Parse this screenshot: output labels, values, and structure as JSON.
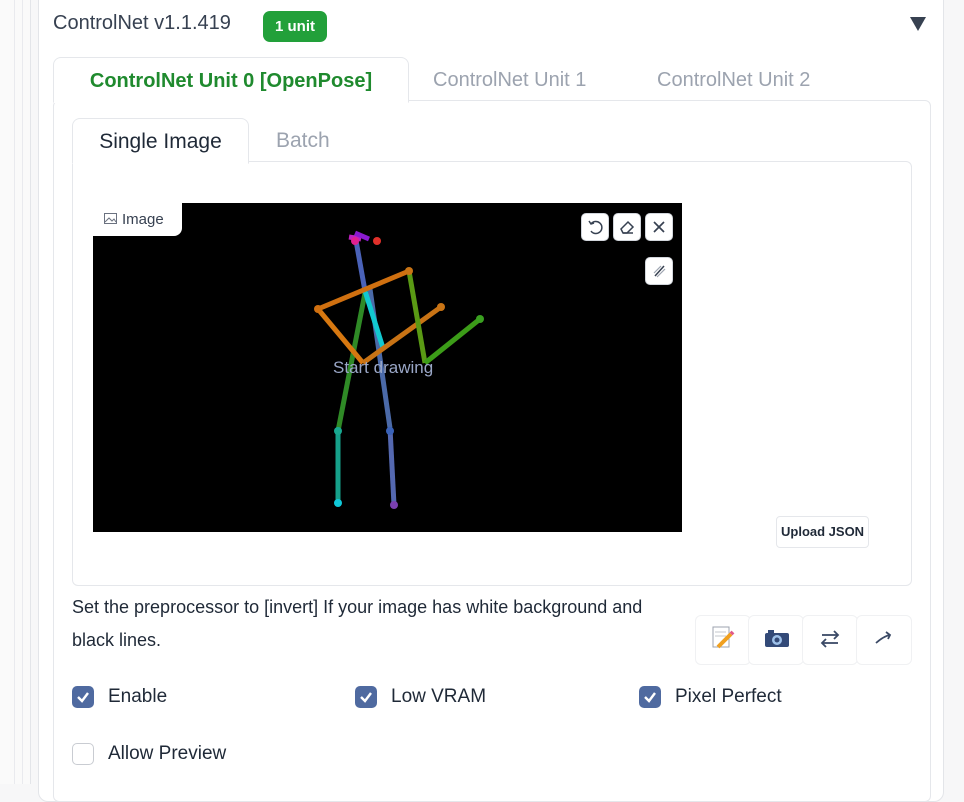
{
  "accordion": {
    "title": "ControlNet v1.1.419",
    "badge": "1 unit",
    "collapse_icon": "triangle-down-icon"
  },
  "unit_tabs": [
    {
      "label": "ControlNet Unit 0 [OpenPose]",
      "active": true
    },
    {
      "label": "ControlNet Unit 1",
      "active": false
    },
    {
      "label": "ControlNet Unit 2",
      "active": false
    }
  ],
  "image_tabs": [
    {
      "label": "Single Image",
      "active": true
    },
    {
      "label": "Batch",
      "active": false
    }
  ],
  "image_panel": {
    "label": "Image",
    "placeholder": "Start drawing",
    "upload_json_label": "Upload JSON",
    "tools": [
      "undo-icon",
      "eraser-icon",
      "close-icon",
      "brush-icon"
    ]
  },
  "hint_text": "Set the preprocessor to [invert] If your image has white background and black lines.",
  "action_icons": [
    "pencil-paper-icon",
    "camera-icon",
    "swap-arrows-icon",
    "send-arrow-icon"
  ],
  "options": {
    "enable": {
      "label": "Enable",
      "checked": true
    },
    "low_vram": {
      "label": "Low VRAM",
      "checked": true
    },
    "pixel_perfect": {
      "label": "Pixel Perfect",
      "checked": true
    },
    "allow_preview": {
      "label": "Allow Preview",
      "checked": false
    }
  },
  "colors": {
    "badge_green": "#22a03a",
    "active_tab_text": "#1f8a2e",
    "checkbox_fill": "#4f6aa0"
  }
}
